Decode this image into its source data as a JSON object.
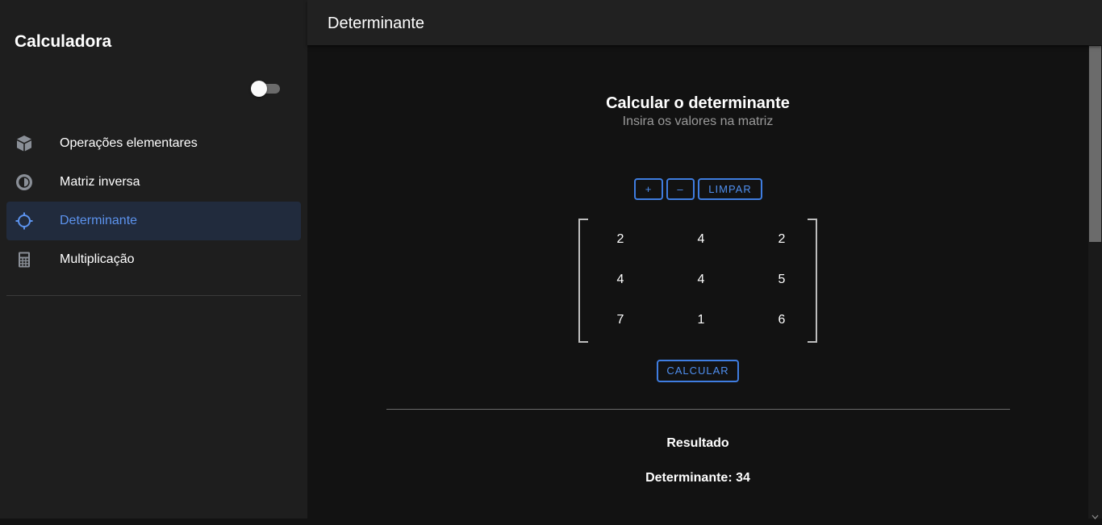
{
  "sidebar": {
    "title": "Calculadora",
    "theme_toggle": {
      "on": false
    },
    "items": [
      {
        "label": "Operações elementares",
        "icon": "cube-icon",
        "active": false
      },
      {
        "label": "Matriz inversa",
        "icon": "contrast-icon",
        "active": false
      },
      {
        "label": "Determinante",
        "icon": "crosshair-icon",
        "active": true
      },
      {
        "label": "Multiplicação",
        "icon": "calculator-icon",
        "active": false
      }
    ]
  },
  "appbar": {
    "title": "Determinante"
  },
  "main": {
    "heading": "Calcular o determinante",
    "subheading": "Insira os valores na matriz",
    "buttons": {
      "add": "+",
      "remove": "–",
      "clear": "LIMPAR",
      "calculate": "CALCULAR"
    },
    "matrix": [
      [
        "2",
        "4",
        "2"
      ],
      [
        "4",
        "4",
        "5"
      ],
      [
        "7",
        "1",
        "6"
      ]
    ],
    "result": {
      "title": "Resultado",
      "value": "Determinante: 34"
    }
  },
  "colors": {
    "accent": "#4f8ff0",
    "sidebar_bg": "#1e1e1e",
    "main_bg": "#121212",
    "active_item_bg": "#212b3d"
  }
}
